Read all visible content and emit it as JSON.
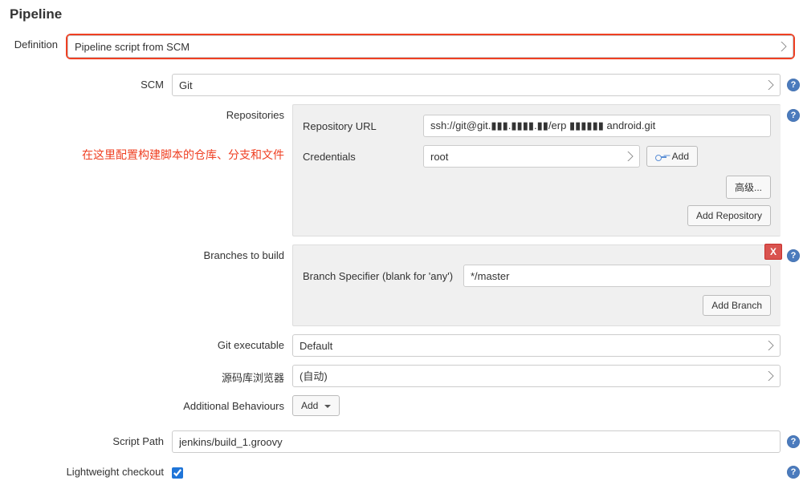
{
  "section_title": "Pipeline",
  "labels": {
    "definition": "Definition",
    "scm": "SCM",
    "repositories": "Repositories",
    "repo_url": "Repository URL",
    "credentials": "Credentials",
    "branches_to_build": "Branches to build",
    "branch_specifier": "Branch Specifier (blank for 'any')",
    "git_executable": "Git executable",
    "source_browser": "源码库浏览器",
    "additional_behaviours": "Additional Behaviours",
    "script_path": "Script Path",
    "lightweight_checkout": "Lightweight checkout"
  },
  "values": {
    "definition": "Pipeline script from SCM",
    "scm": "Git",
    "repo_url": "ssh://git@git.▮▮▮.▮▮▮▮.▮▮/erp ▮▮▮▮▮▮ android.git",
    "credentials": "root",
    "branch_specifier": "*/master",
    "git_executable": "Default",
    "source_browser": "(自动)",
    "script_path": "jenkins/build_1.groovy",
    "lightweight_checkout": true
  },
  "buttons": {
    "add_cred": "Add",
    "advanced": "高级...",
    "add_repository": "Add Repository",
    "add_branch": "Add Branch",
    "add_behaviour": "Add",
    "delete_x": "X"
  },
  "annotation": "在这里配置构建脚本的仓库、分支和文件"
}
